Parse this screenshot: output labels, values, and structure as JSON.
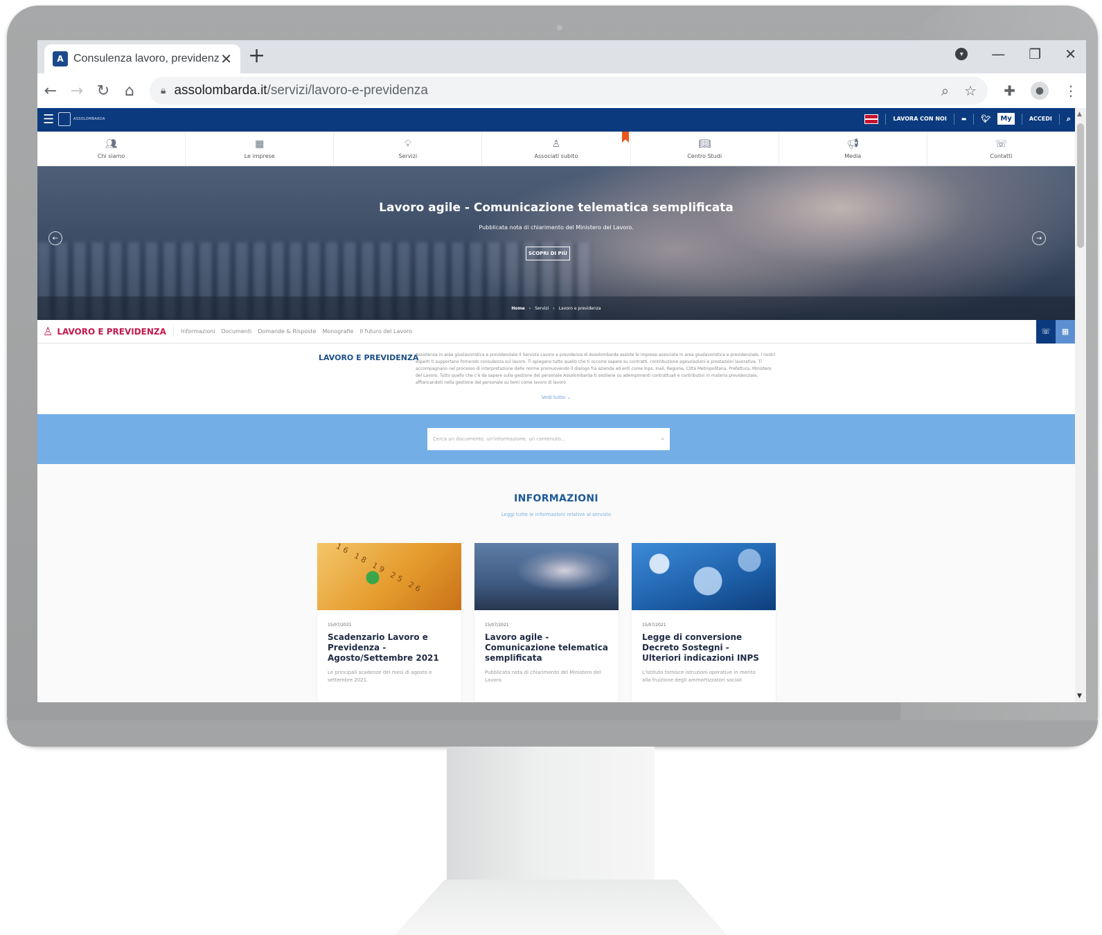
{
  "browser": {
    "tab_title": "Consulenza lavoro, previdenza e",
    "url_host": "assolombarda.it",
    "url_path": "/servizi/lavoro-e-previdenza"
  },
  "site": {
    "logo_text": "ASSOLOMBARDA",
    "topbar": {
      "lavora_label": "LAVORA CON NOI",
      "my_label": "My",
      "login_label": "ACCEDI"
    },
    "menu": [
      {
        "label": "Chi siamo",
        "icon": "people-icon"
      },
      {
        "label": "Le imprese",
        "icon": "building-icon"
      },
      {
        "label": "Servizi",
        "icon": "lightbulb-icon"
      },
      {
        "label": "Associati subito",
        "icon": "person-pin-icon"
      },
      {
        "label": "Centro Studi",
        "icon": "book-icon"
      },
      {
        "label": "Media",
        "icon": "megaphone-icon"
      },
      {
        "label": "Contatti",
        "icon": "phone-icon"
      }
    ]
  },
  "hero": {
    "title": "Lavoro agile - Comunicazione telematica semplificata",
    "subtitle": "Pubblicata nota di chiarimento del Ministero del Lavoro.",
    "cta": "SCOPRI DI PIÙ",
    "breadcrumb": [
      "Home",
      "Servizi",
      "Lavoro e previdenza"
    ]
  },
  "subnav": {
    "title": "LAVORO E PREVIDENZA",
    "links": [
      "Informazioni",
      "Documenti",
      "Domande & Risposte",
      "Monografie",
      "Il futuro del Lavoro"
    ],
    "action_colors": [
      "#0b3a7e",
      "#5b8fd1"
    ]
  },
  "intro": {
    "title": "LAVORO E PREVIDENZA",
    "text": "Assistenza in area giuslavoristica e previdenziale Il Servizio Lavoro e previdenza di Assolombarda assiste le imprese associate in area giuslavoristica e previdenziale. I nostri esperti ti supportano fornendo consulenza sul lavoro. Ti spiegano tutto quello che ti occorre sapere su contratti, contribuzione agevolazioni e prestazioni lavorative. Ti accompagnano nel processo di interpretazione delle norme promuovendo il dialogo fra azienda ed enti come Inps, Inail, Regione, Città Metropolitana, Prefettura, Ministero del Lavoro. Tutto quello che c'è da sapere sulla gestione del personale Assolombarda ti sostiene su adempimenti contrattuali e contributivi in materia previdenziale, affiancandoti nella gestione del personale su temi come lavoro di lavoro",
    "more": "Vedi tutto ⌄"
  },
  "search": {
    "placeholder": "Cerca un documento, un'informazione, un contenuto..."
  },
  "info": {
    "title": "INFORMAZIONI",
    "subtitle": "Leggi tutte le informazioni relative al servizio",
    "cards": [
      {
        "date": "15/07/2021",
        "title": "Scadenzario Lavoro e Previdenza - Agosto/Settembre 2021",
        "text": "Le principali scadenze dei mesi di agosto e settembre 2021."
      },
      {
        "date": "15/07/2021",
        "title": "Lavoro agile - Comunicazione telematica semplificata",
        "text": "Pubblicata nota di chiarimento del Ministero del Lavoro."
      },
      {
        "date": "15/07/2021",
        "title": "Legge di conversione Decreto Sostegni - Ulteriori indicazioni INPS",
        "text": "L'Istituto fornisce istruzioni operative in merito alla fruizione degli ammortizzatori sociali"
      }
    ]
  },
  "colors": {
    "brand_blue": "#0b3a7e",
    "accent_red": "#c2184b",
    "search_band": "#74aee7"
  }
}
